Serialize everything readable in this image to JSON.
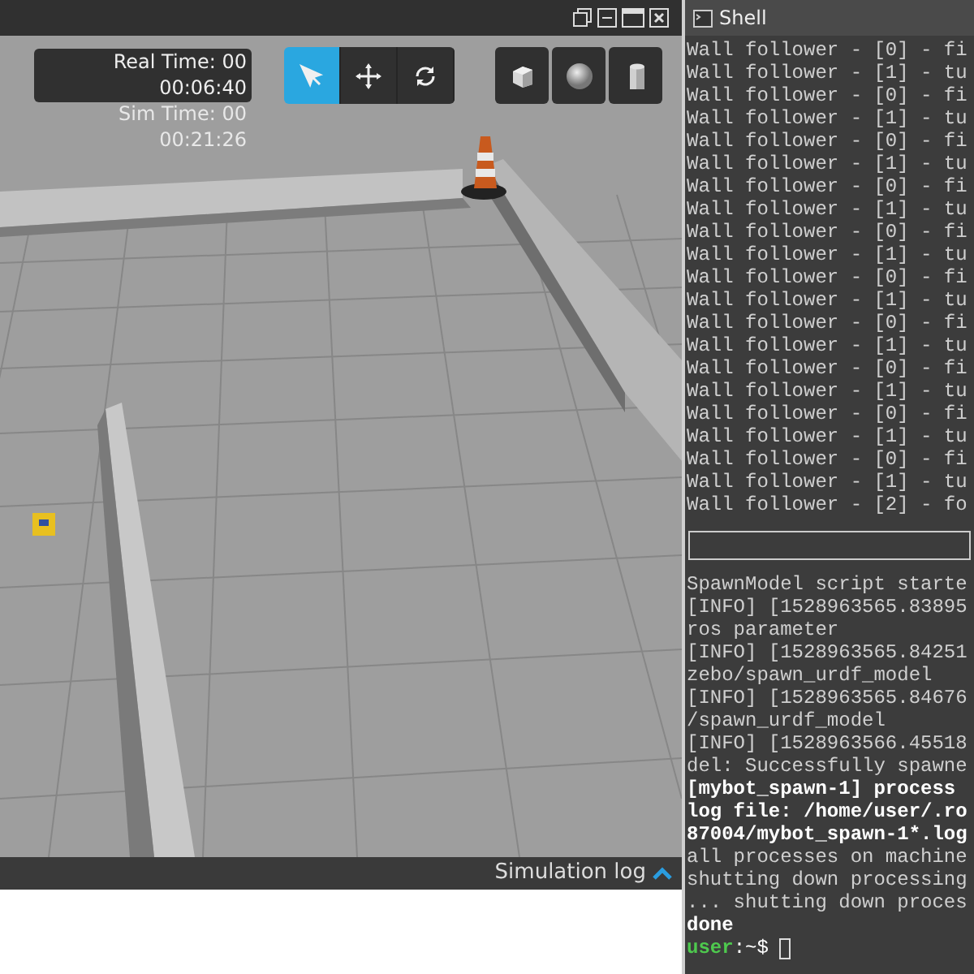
{
  "viewport": {
    "real_time_label": "Real Time: 00",
    "real_time": "00:06:40",
    "sim_time_label": "Sim Time: 00",
    "sim_time": "00:21:26",
    "tools": [
      {
        "kind": "select",
        "selected": true
      },
      {
        "kind": "translate",
        "selected": false
      },
      {
        "kind": "rotate",
        "selected": false
      }
    ],
    "shapes": [
      {
        "kind": "box"
      },
      {
        "kind": "sphere"
      },
      {
        "kind": "cylinder"
      }
    ],
    "status_bar": {
      "label": "Simulation log"
    }
  },
  "shell": {
    "title": "Shell",
    "upper_lines": [
      "Wall follower - [0] - fi",
      "Wall follower - [1] - tu",
      "Wall follower - [0] - fi",
      "Wall follower - [1] - tu",
      "Wall follower - [0] - fi",
      "Wall follower - [1] - tu",
      "Wall follower - [0] - fi",
      "Wall follower - [1] - tu",
      "Wall follower - [0] - fi",
      "Wall follower - [1] - tu",
      "Wall follower - [0] - fi",
      "Wall follower - [1] - tu",
      "Wall follower - [0] - fi",
      "Wall follower - [1] - tu",
      "Wall follower - [0] - fi",
      "Wall follower - [1] - tu",
      "Wall follower - [0] - fi",
      "Wall follower - [1] - tu",
      "Wall follower - [0] - fi",
      "Wall follower - [1] - tu",
      "Wall follower - [2] - fo"
    ],
    "lower_lines": [
      {
        "kind": "normal",
        "text": "SpawnModel script starte"
      },
      {
        "kind": "normal",
        "text": "[INFO] [1528963565.83895"
      },
      {
        "kind": "normal",
        "text": "ros parameter"
      },
      {
        "kind": "normal",
        "text": "[INFO] [1528963565.84251"
      },
      {
        "kind": "normal",
        "text": "zebo/spawn_urdf_model"
      },
      {
        "kind": "normal",
        "text": "[INFO] [1528963565.84676"
      },
      {
        "kind": "normal",
        "text": "/spawn_urdf_model"
      },
      {
        "kind": "normal",
        "text": "[INFO] [1528963566.45518"
      },
      {
        "kind": "normal",
        "text": "del: Successfully spawne"
      },
      {
        "kind": "bold",
        "text": "[mybot_spawn-1] process"
      },
      {
        "kind": "bold",
        "text": "log file: /home/user/.ro"
      },
      {
        "kind": "bold",
        "text": "87004/mybot_spawn-1*.log"
      },
      {
        "kind": "normal",
        "text": "all processes on machine"
      },
      {
        "kind": "normal",
        "text": "shutting down processing"
      },
      {
        "kind": "normal",
        "text": "... shutting down proces"
      },
      {
        "kind": "bold",
        "text": "done"
      }
    ],
    "prompt": {
      "user": "user",
      "suffix": ":~$"
    }
  }
}
